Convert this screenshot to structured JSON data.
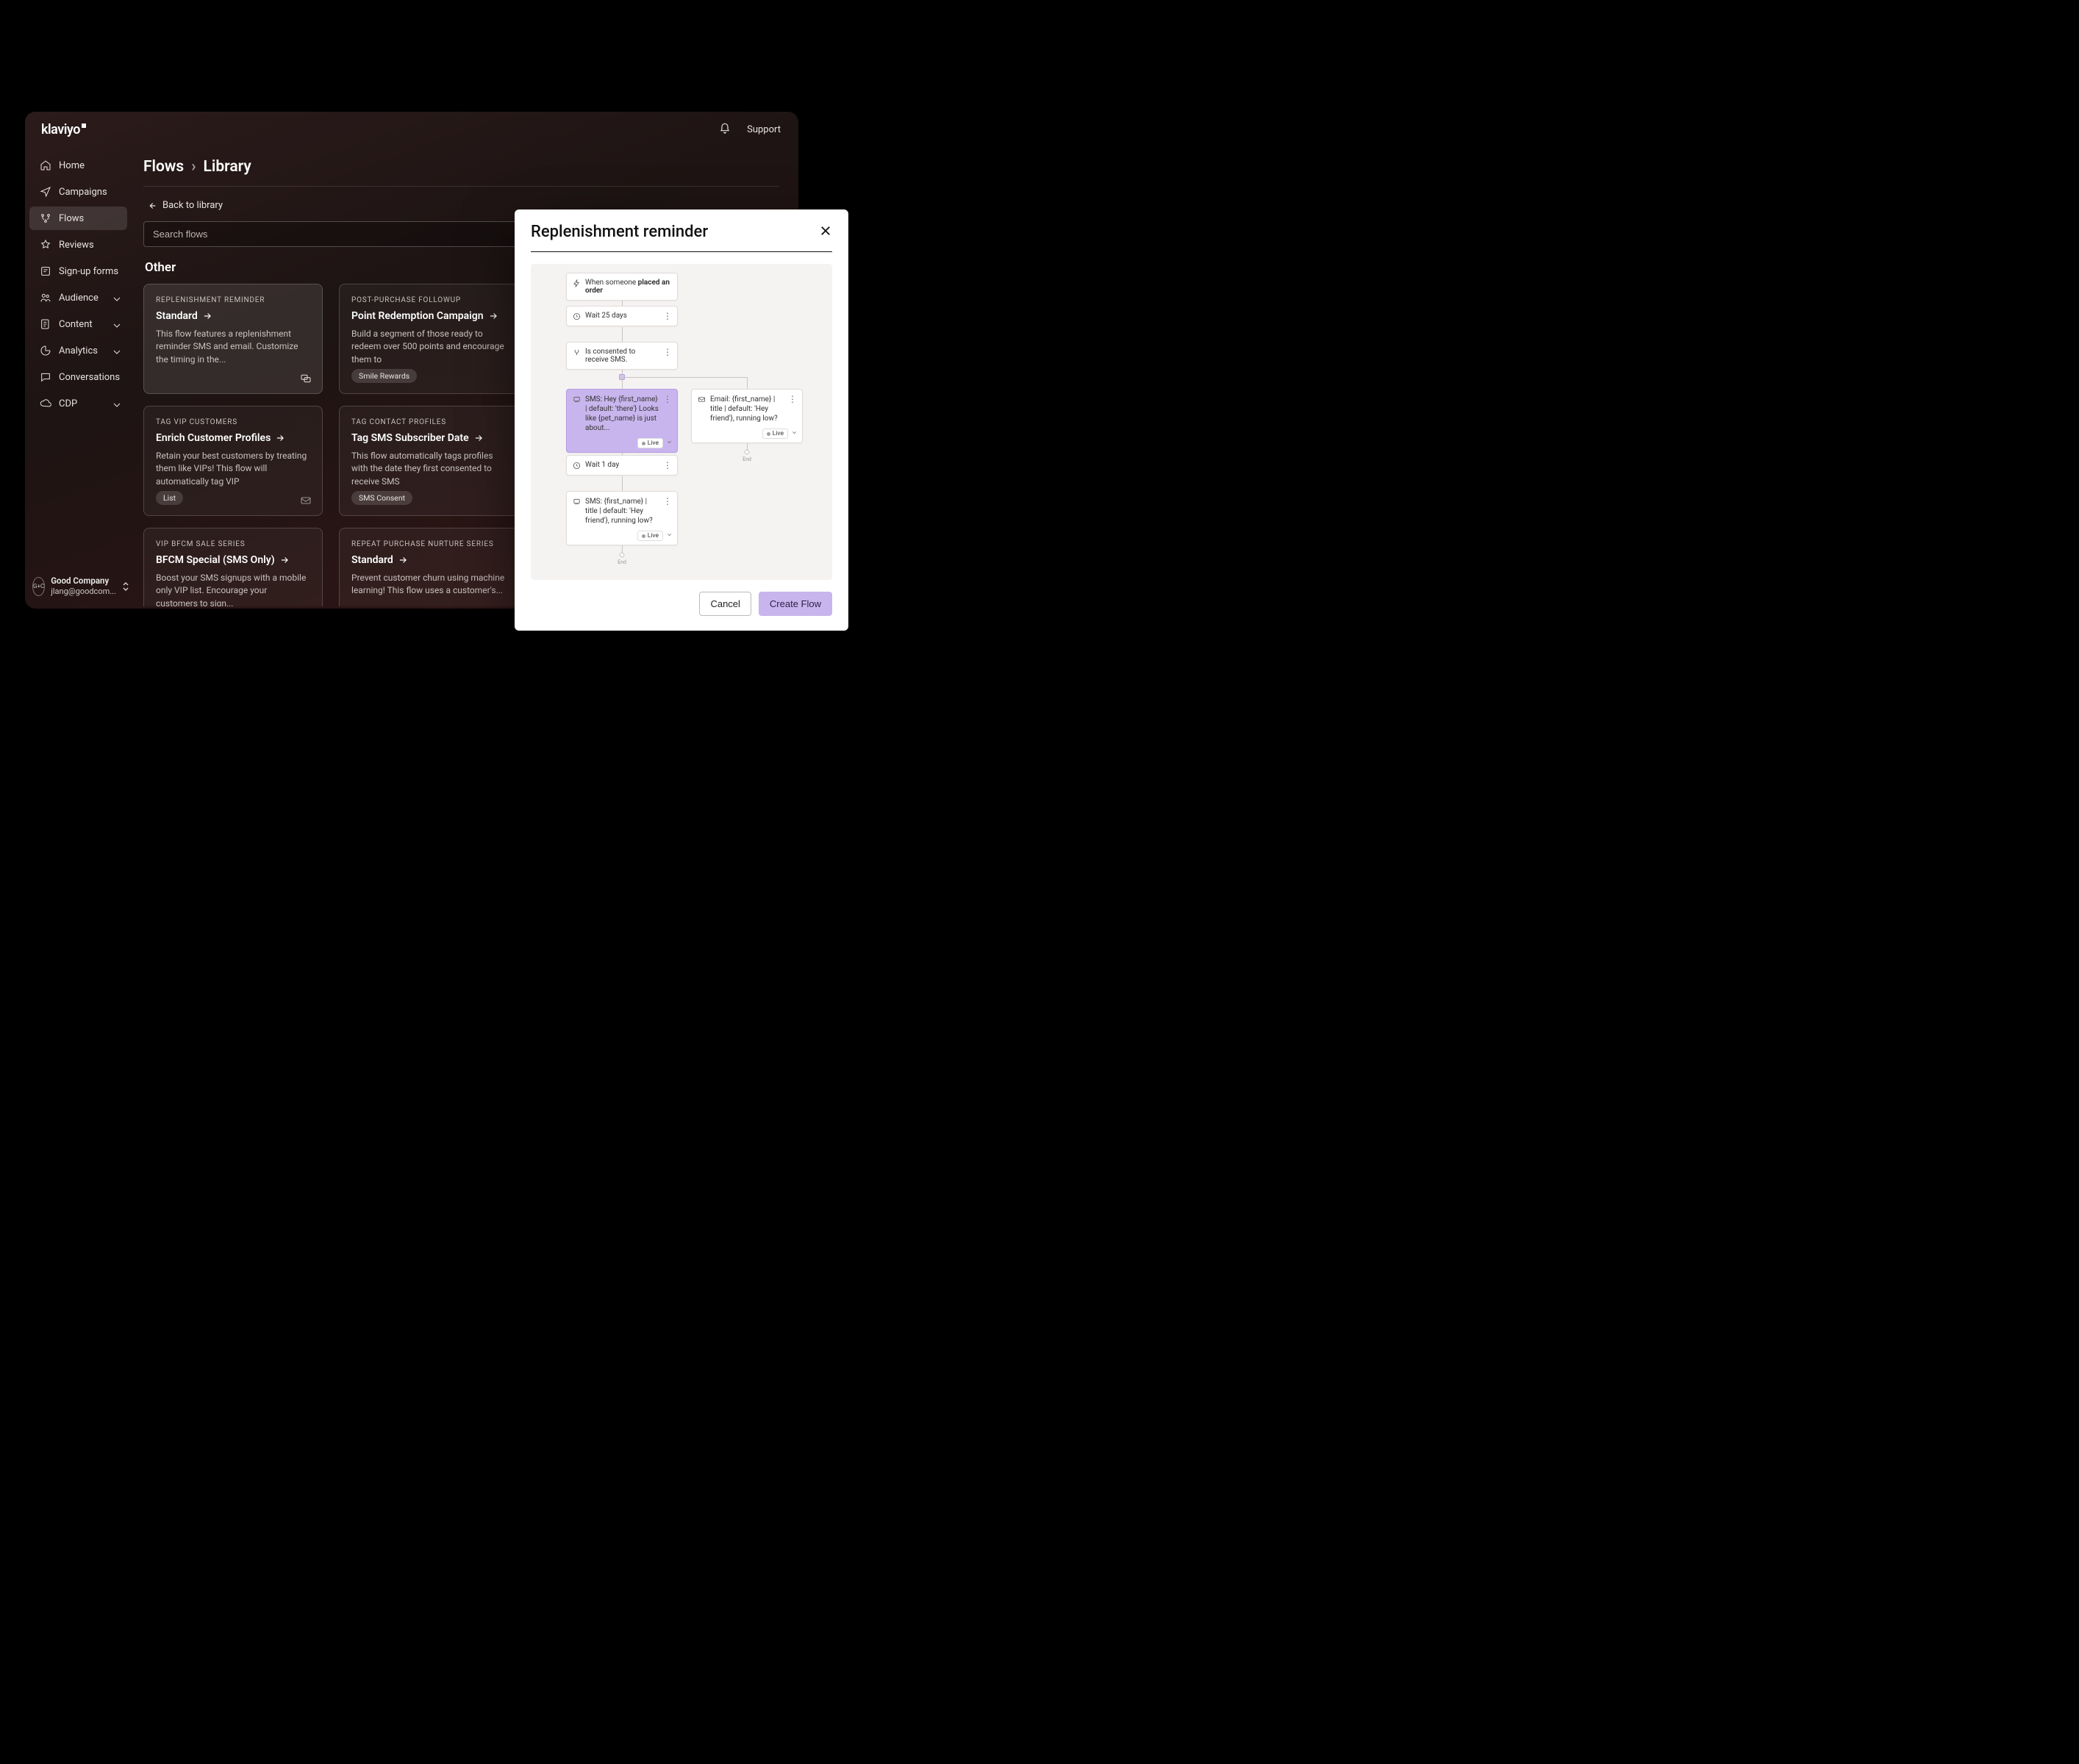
{
  "brand": "klaviyo",
  "topbar": {
    "support": "Support"
  },
  "sidebar": {
    "items": [
      {
        "label": "Home",
        "icon": "home"
      },
      {
        "label": "Campaigns",
        "icon": "send"
      },
      {
        "label": "Flows",
        "icon": "flows",
        "active": true
      },
      {
        "label": "Reviews",
        "icon": "star"
      },
      {
        "label": "Sign-up forms",
        "icon": "form"
      },
      {
        "label": "Audience",
        "icon": "people",
        "expandable": true
      },
      {
        "label": "Content",
        "icon": "content",
        "expandable": true
      },
      {
        "label": "Analytics",
        "icon": "analytics",
        "expandable": true
      },
      {
        "label": "Conversations",
        "icon": "chat"
      },
      {
        "label": "CDP",
        "icon": "cloud",
        "expandable": true
      }
    ],
    "footer": {
      "badge": "G+C",
      "company": "Good Company",
      "email": "jlang@goodcom..."
    }
  },
  "breadcrumbs": {
    "root": "Flows",
    "leaf": "Library"
  },
  "back_link": "Back to library",
  "search": {
    "placeholder": "Search flows"
  },
  "section_title": "Other",
  "cards": [
    {
      "eyebrow": "REPLENISHMENT REMINDER",
      "title": "Standard",
      "desc": "This flow features a replenishment reminder SMS and email. Customize the timing in the...",
      "hover": true,
      "corner_icon": "messages"
    },
    {
      "eyebrow": "POST-PURCHASE FOLLOWUP",
      "title": "Point Redemption Campaign",
      "desc": "Build a segment of those ready to redeem over 500 points and encourage them to",
      "tags": [
        "Smile Rewards"
      ]
    },
    {
      "eyebrow": "TAG VIP CUSTOMERS",
      "title": "Enrich Customer Profiles",
      "desc": "Retain your best customers by treating them like VIPs! This flow will automatically tag VIP",
      "tags": [
        "List"
      ],
      "corner_icon": "mail"
    },
    {
      "eyebrow": "TAG CONTACT PROFILES",
      "title": "Tag SMS Subscriber Date",
      "desc": "This flow automatically tags profiles with the date they first consented to receive SMS",
      "tags": [
        "SMS Consent"
      ]
    },
    {
      "eyebrow": "VIP BFCM SALE SERIES",
      "title": "BFCM Special (SMS Only)",
      "desc": "Boost your SMS signups with a mobile only VIP list. Encourage your customers to sign..."
    },
    {
      "eyebrow": "REPEAT PURCHASE NURTURE SERIES",
      "title": "Standard",
      "desc": "Prevent customer churn using machine learning! This flow uses a customer's..."
    }
  ],
  "modal": {
    "title": "Replenishment reminder",
    "trigger_prefix": "When someone",
    "trigger_bold": "placed an order",
    "wait1": "Wait 25 days",
    "split": "Is consented to receive SMS.",
    "sms1": "SMS: Hey {first_name} | default: 'there'} Looks like {pet_name} is just about...",
    "email1": "Email: {first_name} | title | default: 'Hey friend'}, running low?",
    "wait2": "Wait 1 day",
    "sms2": "SMS: {first_name} | title | default: 'Hey friend'}, running low?",
    "live": "Live",
    "end": "End",
    "cancel": "Cancel",
    "create": "Create Flow"
  }
}
